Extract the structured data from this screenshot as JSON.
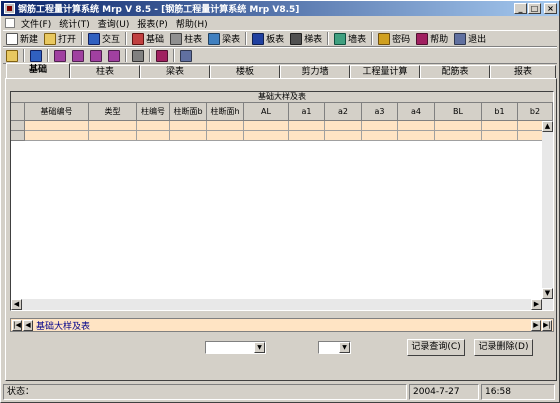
{
  "window": {
    "title": "钢筋工程量计算系统 Mrp V 8.5 - [钢筋工程量计算系统 Mrp V8.5]"
  },
  "menu": [
    "文件(F)",
    "统计(T)",
    "查询(U)",
    "报表(P)",
    "帮助(H)"
  ],
  "toolbar1": [
    "新建",
    "打开",
    "交互",
    "基础",
    "柱表",
    "梁表",
    "板表",
    "梯表",
    "墙表",
    "密码",
    "帮助",
    "退出"
  ],
  "tabs": [
    "基础",
    "柱表",
    "梁表",
    "楼板",
    "剪力墙",
    "工程量计算",
    "配筋表",
    "报表"
  ],
  "grid": {
    "caption": "基础大样及表",
    "columns": [
      "基础编号",
      "类型",
      "柱编号",
      "柱断面b",
      "柱断面h",
      "AL",
      "a1",
      "a2",
      "a3",
      "a4",
      "BL",
      "b1",
      "b2"
    ]
  },
  "nav": {
    "label": "基础大样及表",
    "first": "|◀",
    "prev": "◀",
    "next": "▶",
    "last": "▶|"
  },
  "buttons": {
    "query": "记录查询(C)",
    "delete": "记录删除(D)"
  },
  "status": {
    "label": "状态：",
    "date": "2004-7-27",
    "time": "16:58"
  },
  "colors": {
    "title_start": "#0a246a",
    "title_end": "#a6caf0",
    "row_fill": "#ffe4c4",
    "face": "#d4d0c8"
  }
}
